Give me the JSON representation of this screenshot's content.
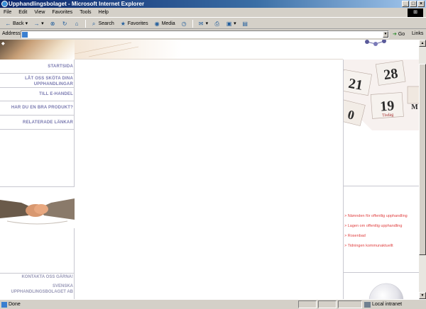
{
  "window": {
    "title": "Upphandlingsbolaget - Microsoft Internet Explorer"
  },
  "menu": {
    "items": [
      "File",
      "Edit",
      "View",
      "Favorites",
      "Tools",
      "Help"
    ]
  },
  "toolbar": {
    "back_label": "Back",
    "search_label": "Search",
    "favorites_label": "Favorites",
    "media_label": "Media"
  },
  "address": {
    "label": "Address",
    "value": "",
    "go_label": "Go",
    "links_label": "Links"
  },
  "status": {
    "text": "Done",
    "zone": "Local intranet"
  },
  "page": {
    "nav": [
      "STARTSIDA",
      "LÅT OSS SKÖTA DINA UPPHANDLINGAR",
      "TILL E-HANDEL",
      "HAR DU EN BRA PRODUKT?",
      "RELATERADE LÄNKAR"
    ],
    "contact": [
      "KONTAKTA OSS GÄRNA!",
      "SVENSKA",
      "UPPHANDLINGSBOLAGET AB"
    ],
    "calendar": {
      "numbers": [
        "28",
        "21",
        "19",
        "0"
      ],
      "day_label": "Tisdag",
      "month_letter": "M"
    },
    "links": [
      "> Nämnden för offentlig upphandling",
      "> Lagen om offentlig upphandling",
      "> Rosenbad",
      "> Tidningen kommunaktuellt"
    ]
  },
  "colors": {
    "nav_text": "#7a7ab0",
    "link_text": "#e04040",
    "title_bar": "#0a246a"
  }
}
